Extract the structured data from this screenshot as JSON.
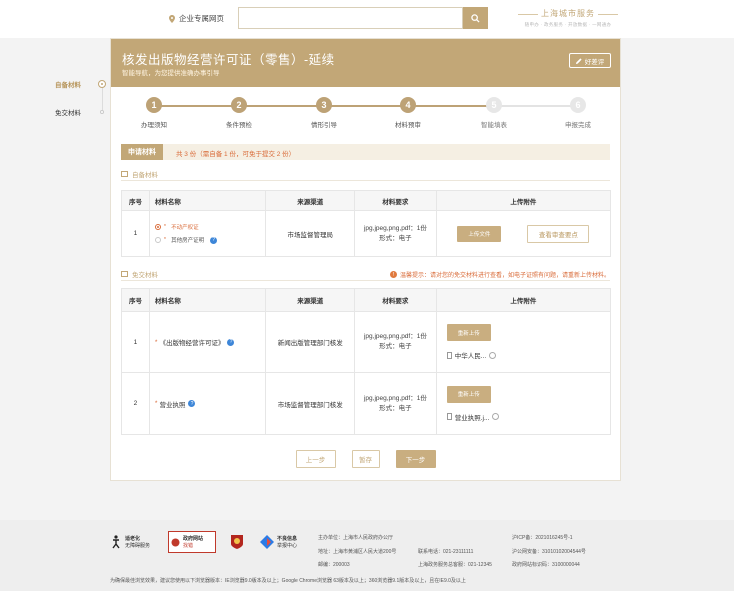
{
  "header": {
    "home_link": "企业专属网页",
    "search_placeholder": "",
    "brand_title": "上海城市服务",
    "brand_subtitle": "随申办 · 政务服务 · 开放数据 · 一网通办"
  },
  "sidebar": {
    "items": [
      {
        "label": "自备材料"
      },
      {
        "label": "免交材料"
      }
    ]
  },
  "hero": {
    "title": "核发出版物经营许可证（零售）-延续",
    "subtitle": "智能导航，为您提供准确办事引导",
    "eval_button": "好差评"
  },
  "steps": [
    {
      "num": "1",
      "label": "办理须知",
      "done": true
    },
    {
      "num": "2",
      "label": "条件预检",
      "done": true
    },
    {
      "num": "3",
      "label": "情形引导",
      "done": true
    },
    {
      "num": "4",
      "label": "材料预审",
      "done": true
    },
    {
      "num": "5",
      "label": "智能填表",
      "done": false
    },
    {
      "num": "6",
      "label": "申报完成",
      "done": false
    }
  ],
  "materials": {
    "tab": "申请材料",
    "count_text": "共 3 份（需自备 1 份，可免于提交 2 份）",
    "self_section": "自备材料",
    "exempt_section": "免交材料",
    "tip": "温馨提示：请对您的免交材料进行查看，如电子证照有问题，请重新上传材料。",
    "columns": [
      "序号",
      "材料名称",
      "来源渠道",
      "材料要求",
      "上传附件"
    ],
    "self_rows": [
      {
        "no": "1",
        "options": [
          "不动产权证",
          "其他房产证明"
        ],
        "source": "市场监督管理局",
        "req_line1": "jpg,jpeg,png,pdf：1份",
        "req_line2": "形式：电子",
        "upload_btn": "上传文件",
        "view_btn": "查看审查要点"
      }
    ],
    "exempt_rows": [
      {
        "no": "1",
        "name": "《出版物经营许可证》",
        "source": "新闻出版管理部门核发",
        "req_line1": "jpg,jpeg,png,pdf：1份",
        "req_line2": "形式：电子",
        "reupload_btn": "重新上传",
        "file_name": "中华人民..."
      },
      {
        "no": "2",
        "name": "营业执照",
        "source": "市场监督管理部门核发",
        "req_line1": "jpg,jpeg,png,pdf：1份",
        "req_line2": "形式：电子",
        "reupload_btn": "重新上传",
        "file_name": "营业执照.j..."
      }
    ]
  },
  "buttons": {
    "prev": "上一步",
    "save": "暂存",
    "next": "下一步"
  },
  "footer": {
    "logo1_title": "适老化",
    "logo1_sub": "无障碍服务",
    "logo2_title": "政府网站",
    "logo2_sub": "找错",
    "logo4_title": "不良信息",
    "logo4_sub": "举报中心",
    "host": "主办单位：上海市人民政府办公厅",
    "address": "地址：上海市黄浦区人民大道200号",
    "postcode": "邮编：200003",
    "phone": "联系电话：021-23111111",
    "service_phone": "上海政务服务总客服：021-12345",
    "icp": "沪ICP备：2021016245号-1",
    "police": "沪公网安备：31010102004544号",
    "site_id": "政府网站标识码：3100000044",
    "browser_note": "为确保最佳浏览效果，建议您使用以下浏览器版本：IE浏览器9.0版本及以上；Google Chrome浏览器 63版本及以上；360浏览器9.1版本及以上，且在IE9.0及以上"
  },
  "colors": {
    "accent": "#c2a777",
    "warning": "#d96b39",
    "info": "#3d86d8"
  }
}
